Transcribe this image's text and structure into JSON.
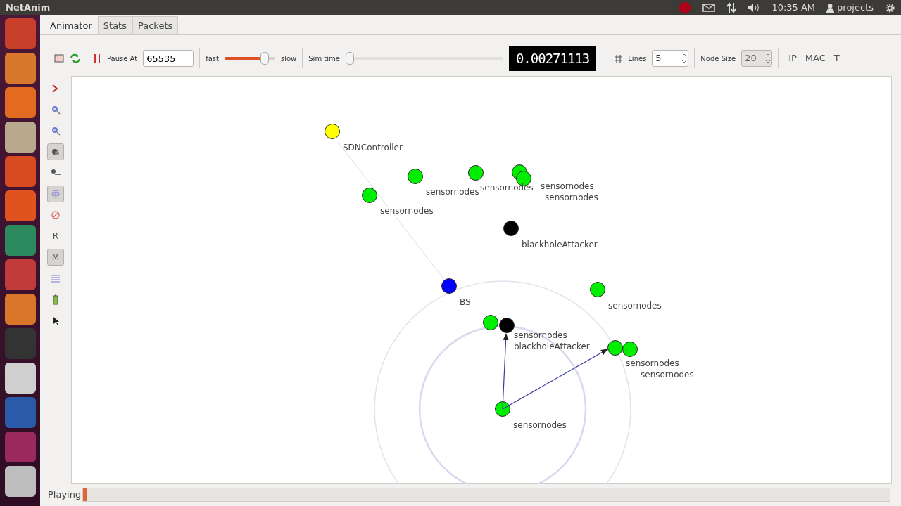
{
  "window": {
    "title": "NetAnim"
  },
  "panel": {
    "time": "10:35 AM",
    "user": "projects"
  },
  "launcher": [
    {
      "color": "#c8402a"
    },
    {
      "color": "#d9772c"
    },
    {
      "color": "#e26a21"
    },
    {
      "color": "#b8a98c"
    },
    {
      "color": "#d84a1f"
    },
    {
      "color": "#e0531f"
    },
    {
      "color": "#2d8a5e"
    },
    {
      "color": "#c23b3b"
    },
    {
      "color": "#d9762a"
    },
    {
      "color": "#333333"
    },
    {
      "color": "#cfcfcf"
    },
    {
      "color": "#2a5aa8"
    },
    {
      "color": "#9a2a5e"
    },
    {
      "color": "#bdbdbd"
    }
  ],
  "tabs": [
    {
      "label": "Animator",
      "selected": true
    },
    {
      "label": "Stats",
      "selected": false
    },
    {
      "label": "Packets",
      "selected": false
    }
  ],
  "toolbar": {
    "pause_label": "Pause At",
    "pause_value": "65535",
    "fast_label": "fast",
    "slow_label": "slow",
    "speed_slider": {
      "level": 0.85
    },
    "sim_time_label": "Sim time",
    "sim_time_slider": {
      "level": 0.0
    },
    "clock": "0.00271113",
    "lines_label": "Lines",
    "lines_value": "5",
    "node_size_label": "Node Size",
    "node_size_value": "20",
    "buttons": [
      "IP",
      "MAC",
      "T"
    ]
  },
  "side_tools": [
    {
      "kind": "icon"
    },
    {
      "kind": "icon"
    },
    {
      "kind": "icon"
    },
    {
      "kind": "icon"
    },
    {
      "kind": "icon"
    },
    {
      "kind": "icon"
    },
    {
      "kind": "icon"
    },
    {
      "kind": "text",
      "label": "R"
    },
    {
      "kind": "text",
      "label": "M"
    },
    {
      "kind": "icon"
    },
    {
      "kind": "icon"
    },
    {
      "kind": "icon"
    }
  ],
  "nodes": [
    {
      "label": "SDNController",
      "color": "#ffff00"
    },
    {
      "label": "sensornodes",
      "color": "#00ee00"
    },
    {
      "label": "sensornodes",
      "color": "#00ee00"
    },
    {
      "label": "sensornodes",
      "color": "#00ee00"
    },
    {
      "label": "sensornodes",
      "color": "#00ee00"
    },
    {
      "label": "sensornodes",
      "color": "#00ee00"
    },
    {
      "label": "blackholeAttacker",
      "color": "#000000"
    },
    {
      "label": "BS",
      "color": "#0000ff"
    },
    {
      "label": "sensornodes",
      "color": "#00ee00"
    },
    {
      "label": "sensornodes",
      "color": "#00ee00"
    },
    {
      "label": "blackholeAttacker",
      "color": "#000000"
    },
    {
      "label": "sensornodes",
      "color": "#00ee00"
    },
    {
      "label": "sensornodes",
      "color": "#00ee00"
    },
    {
      "label": "sensornodes",
      "color": "#00ee00"
    }
  ],
  "status": {
    "label": "Playing",
    "level": 0.005
  }
}
